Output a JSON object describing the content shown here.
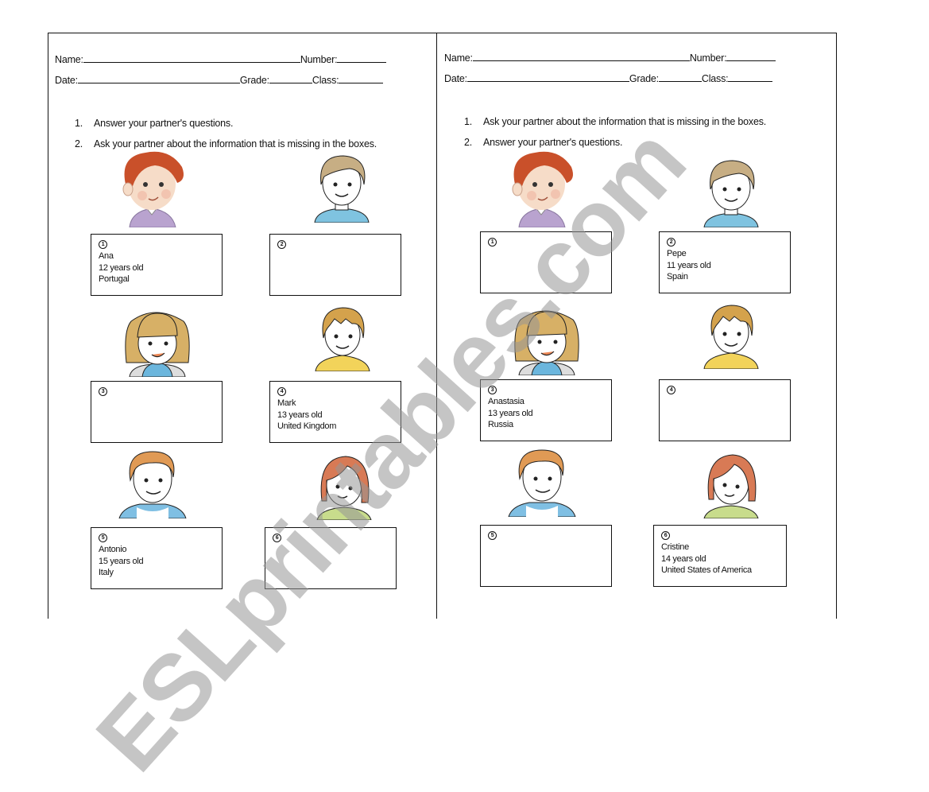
{
  "worksheets": [
    {
      "header": {
        "name_label": "Name:",
        "number_label": "Number:",
        "date_label": "Date:",
        "grade_label": "Grade:",
        "class_label": "Class:"
      },
      "instructions": [
        {
          "num": "1.",
          "text": "Answer your partner's questions."
        },
        {
          "num": "2.",
          "text": "Ask your partner about the information that is missing in the boxes."
        }
      ],
      "cards": [
        {
          "badge": "1",
          "name": "Ana",
          "age": "12 years old",
          "country": "Portugal"
        },
        {
          "badge": "2",
          "name": "",
          "age": "",
          "country": ""
        },
        {
          "badge": "3",
          "name": "",
          "age": "",
          "country": ""
        },
        {
          "badge": "4",
          "name": "Mark",
          "age": "13 years old",
          "country": "United Kingdom"
        },
        {
          "badge": "5",
          "name": "Antonio",
          "age": "15 years old",
          "country": "Italy"
        },
        {
          "badge": "6",
          "name": "",
          "age": "",
          "country": ""
        }
      ]
    },
    {
      "header": {
        "name_label": "Name:",
        "number_label": "Number:",
        "date_label": "Date:",
        "grade_label": "Grade:",
        "class_label": "Class:"
      },
      "instructions": [
        {
          "num": "1.",
          "text": "Ask your partner about the information that is missing in the boxes."
        },
        {
          "num": "2.",
          "text": "Answer your partner's questions."
        }
      ],
      "cards": [
        {
          "badge": "1",
          "name": "",
          "age": "",
          "country": ""
        },
        {
          "badge": "2",
          "name": "Pepe",
          "age": "11 years old",
          "country": "Spain"
        },
        {
          "badge": "3",
          "name": "Anastasia",
          "age": "13 years old",
          "country": "Russia"
        },
        {
          "badge": "4",
          "name": "",
          "age": "",
          "country": ""
        },
        {
          "badge": "5",
          "name": "",
          "age": "",
          "country": ""
        },
        {
          "badge": "6",
          "name": "Cristine",
          "age": "14 years old",
          "country": "United States of America"
        }
      ]
    }
  ],
  "characters": [
    {
      "id": "red-haired-girl",
      "hair": "#c9502a",
      "shirt": "#b9a3cf",
      "skin": "#f6dcc8"
    },
    {
      "id": "brown-haired-boy",
      "hair": "#c7ae84",
      "shirt": "#7fc3e0",
      "skin": "#ffffff"
    },
    {
      "id": "blonde-girl",
      "hair": "#d7b066",
      "shirt": "#6bb6dd",
      "skin": "#ffffff"
    },
    {
      "id": "blond-boy",
      "hair": "#d4a24c",
      "shirt": "#f2d35a",
      "skin": "#ffffff"
    },
    {
      "id": "ginger-boy",
      "hair": "#e09a55",
      "shirt": "#7fbfe3",
      "skin": "#ffffff"
    },
    {
      "id": "auburn-girl",
      "hair": "#d87a55",
      "shirt": "#c8dc8c",
      "skin": "#ffffff"
    }
  ],
  "watermark": "ESLprintables.com"
}
